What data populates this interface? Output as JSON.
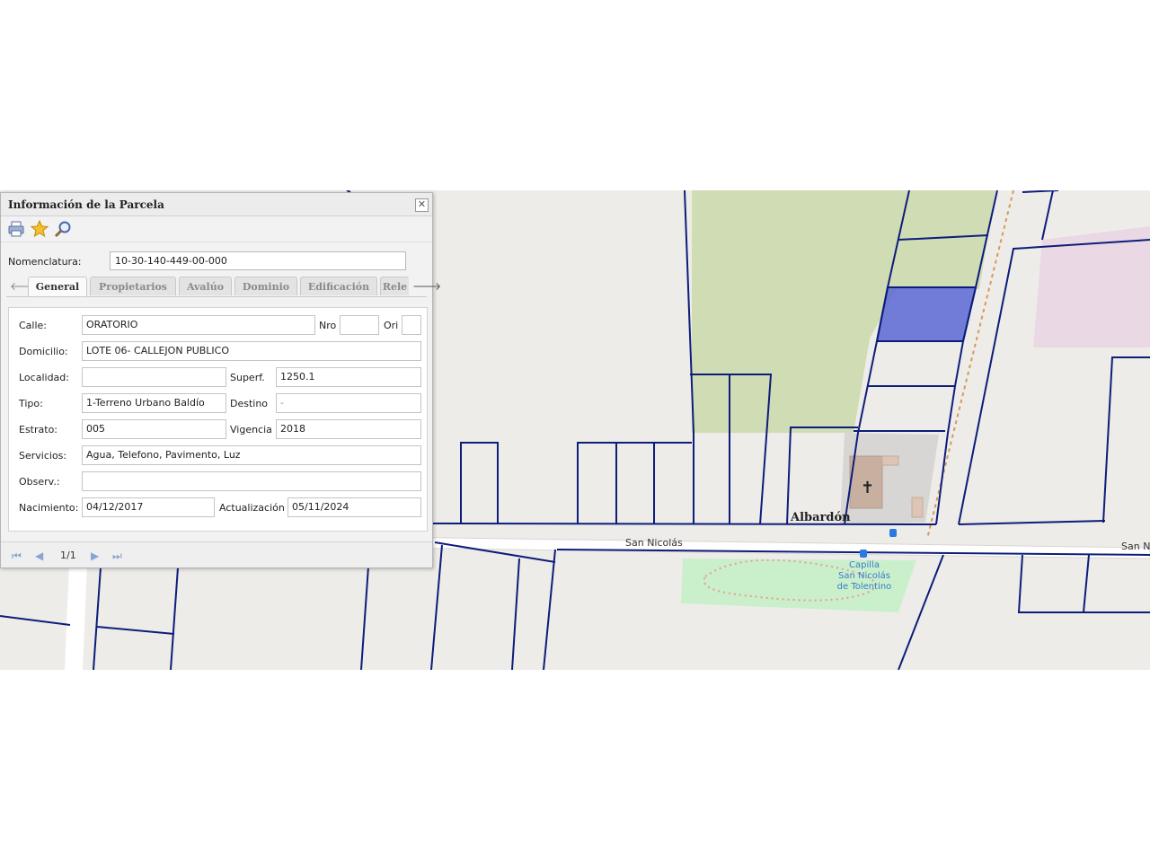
{
  "panel": {
    "title": "Información de la Parcela",
    "close_glyph": "✕",
    "toolbar": [
      {
        "icon": "printer-icon"
      },
      {
        "icon": "star-icon"
      },
      {
        "icon": "magnifier-icon"
      }
    ],
    "nomenclatura": {
      "label": "Nomenclatura:",
      "value": "10-30-140-449-00-000"
    },
    "tabs": [
      "General",
      "Propietarios",
      "Avalúo",
      "Dominio",
      "Edificación",
      "Rele"
    ],
    "active_tab": "General",
    "fields": {
      "calle": {
        "label": "Calle:",
        "value": "ORATORIO"
      },
      "nro": {
        "label": "Nro",
        "value": ""
      },
      "ori": {
        "label": "Ori",
        "value": ""
      },
      "domicilio": {
        "label": "Domicilio:",
        "value": "LOTE 06- CALLEJON PUBLICO"
      },
      "localidad": {
        "label": "Localidad:",
        "value": ""
      },
      "superf": {
        "label": "Superf.",
        "value": "1250.1"
      },
      "tipo": {
        "label": "Tipo:",
        "value": "1-Terreno Urbano Baldío"
      },
      "destino": {
        "label": "Destino",
        "value": "-"
      },
      "estrato": {
        "label": "Estrato:",
        "value": "005"
      },
      "vigencia": {
        "label": "Vigencia",
        "value": "2018"
      },
      "servicios": {
        "label": "Servicios:",
        "value": "Agua, Telefono, Pavimento, Luz"
      },
      "observ": {
        "label": "Observ.:",
        "value": ""
      },
      "nacimiento": {
        "label": "Nacimiento:",
        "value": "04/12/2017"
      },
      "actualizacion": {
        "label": "Actualización",
        "value": "05/11/2024"
      }
    },
    "pager": {
      "text": "1/1"
    }
  },
  "map": {
    "labels": {
      "street_left": "San Nicolás",
      "street_right": "San Ni",
      "town": "Albardón",
      "poi_line1": "Capilla",
      "poi_line2": "San Nicolás",
      "poi_line3": "de Tolentino"
    },
    "colors": {
      "parcel_line": "#0d1d7a",
      "selected_parcel": "#5b68d6",
      "vegetation": "#cfdcb4",
      "road": "#ffffff",
      "background": "#eeece9",
      "park": "#c9f0cb",
      "residential": "#ead8e5"
    }
  }
}
